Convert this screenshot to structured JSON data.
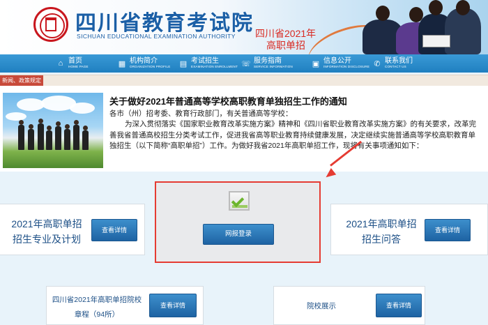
{
  "header": {
    "site_name": "四川省教育考试院",
    "site_name_en": "SICHUAN EDUCATIONAL EXAMINATION AUTHORITY",
    "banner_line1": "四川省2021年",
    "banner_line2": "高职单招"
  },
  "nav": {
    "items": [
      {
        "label": "首页",
        "label_en": "HOME PAGE",
        "icon": "home-icon"
      },
      {
        "label": "机构简介",
        "label_en": "ORGANIZATION PROFILE",
        "icon": "org-icon"
      },
      {
        "label": "考试招生",
        "label_en": "EXAMINATION ENROLLMENT",
        "icon": "exam-icon"
      },
      {
        "label": "服务指南",
        "label_en": "SERVICE INFORMATION",
        "icon": "service-icon"
      },
      {
        "label": "信息公开",
        "label_en": "INFORMATION DISCLOSURE",
        "icon": "info-icon"
      },
      {
        "label": "联系我们",
        "label_en": "CONTACT US",
        "icon": "contact-icon"
      }
    ]
  },
  "breadcrumb": {
    "label": "新闻、政策规定"
  },
  "news": {
    "title": "关于做好2021年普通高等学校高职教育单独招生工作的通知",
    "salutation": "各市（州）招考委、教育行政部门，有关普通高等学校：",
    "body": "为深入贯彻落实《国家职业教育改革实施方案》精神和《四川省职业教育改革实施方案》的有关要求，改革完善我省普通高校招生分类考试工作，促进我省高等职业教育持续健康发展，决定继续实施普通高等学校高职教育单独招生（以下简称“高职单招”）工作。为做好我省2021年高职单招工作，现将有关事项通知如下："
  },
  "cards": {
    "majors": {
      "line1": "2021年高职单招",
      "line2": "招生专业及计划",
      "button": "查看详情"
    },
    "login": {
      "button": "网报登录",
      "icon": "checkbox-icon"
    },
    "faq": {
      "line1": "2021年高职单招",
      "line2": "招生问答",
      "button": "查看详情"
    },
    "schools": {
      "line1": "四川省2021年高职单招院校",
      "line2": "章程（94所）",
      "button": "查看详情"
    },
    "showcase": {
      "label": "院校展示",
      "button": "查看详情"
    }
  },
  "colors": {
    "accent": "#1f7fc0",
    "highlight": "#e53b32",
    "brand_red": "#c8161d"
  }
}
